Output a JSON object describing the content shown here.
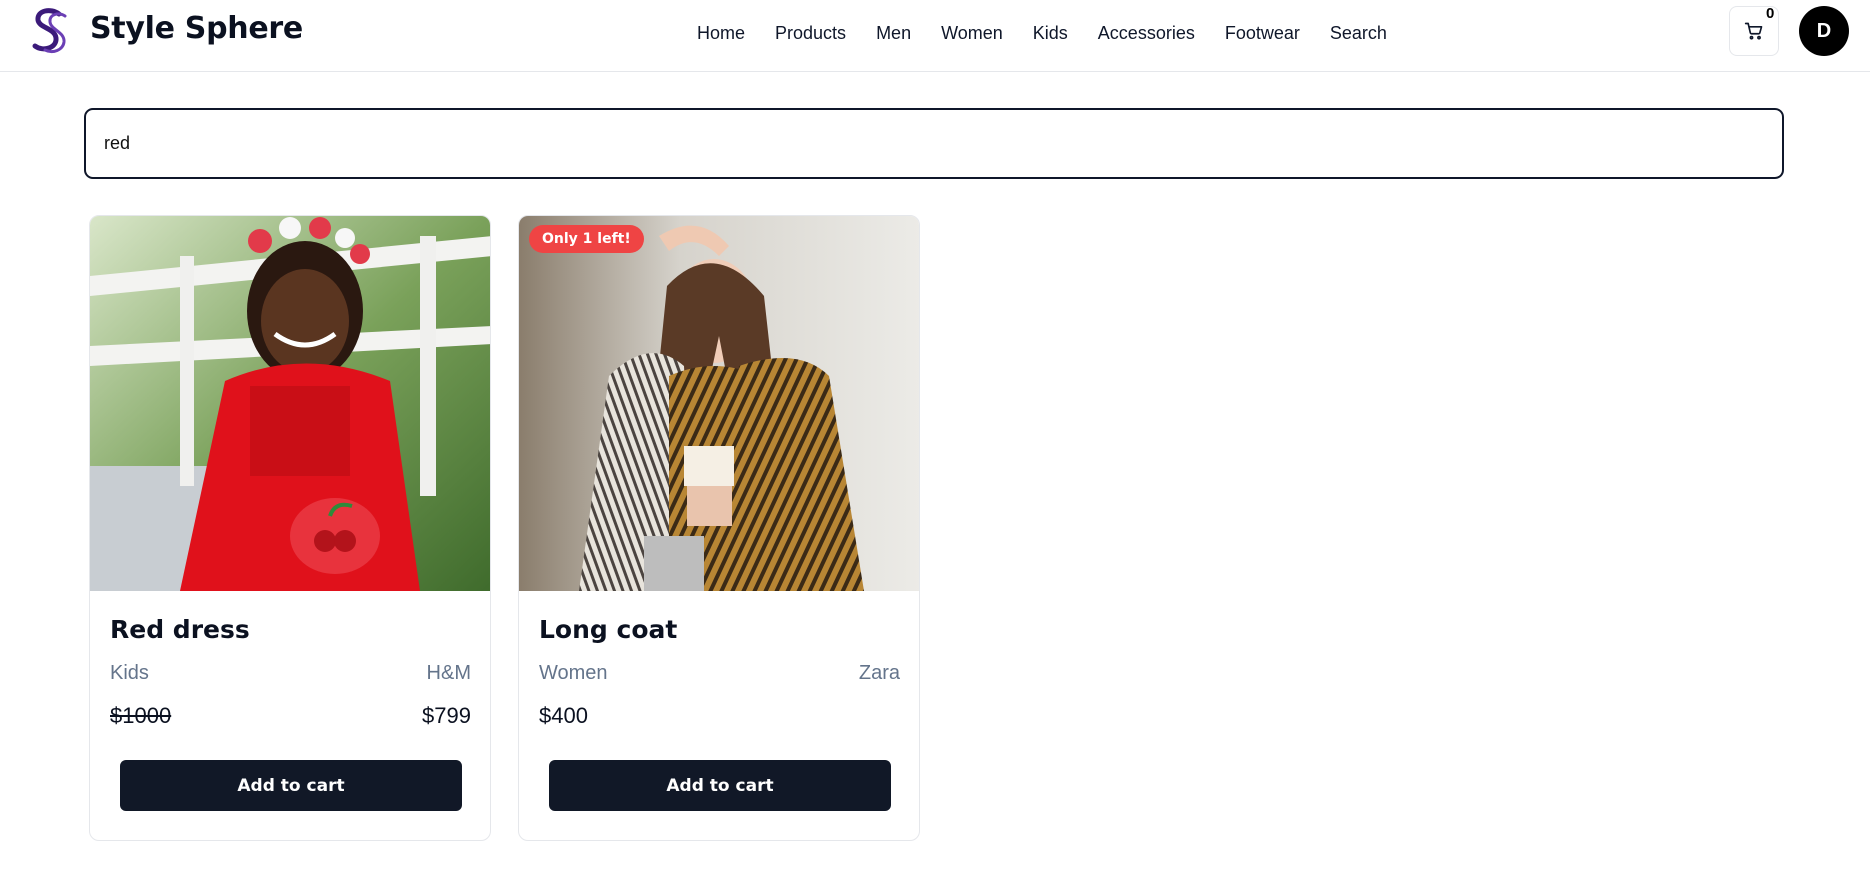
{
  "header": {
    "brand": "Style Sphere",
    "logo_icon": "style-sphere-monogram-icon",
    "nav": [
      "Home",
      "Products",
      "Men",
      "Women",
      "Kids",
      "Accessories",
      "Footwear",
      "Search"
    ],
    "cart_count": "0",
    "cart_icon": "cart-icon",
    "avatar_initial": "D"
  },
  "search": {
    "value": "red"
  },
  "products": [
    {
      "title": "Red dress",
      "category": "Kids",
      "brand": "H&M",
      "original_price": "$1000",
      "price": "$799",
      "button": "Add to cart",
      "badge": ""
    },
    {
      "title": "Long coat",
      "category": "Women",
      "brand": "Zara",
      "price": "$400",
      "button": "Add to cart",
      "badge": "Only 1 left!"
    }
  ],
  "colors": {
    "brand_purple": "#3b1a7a",
    "button_dark": "#111827",
    "badge_red": "#ef4444",
    "muted_text": "#64748b"
  }
}
